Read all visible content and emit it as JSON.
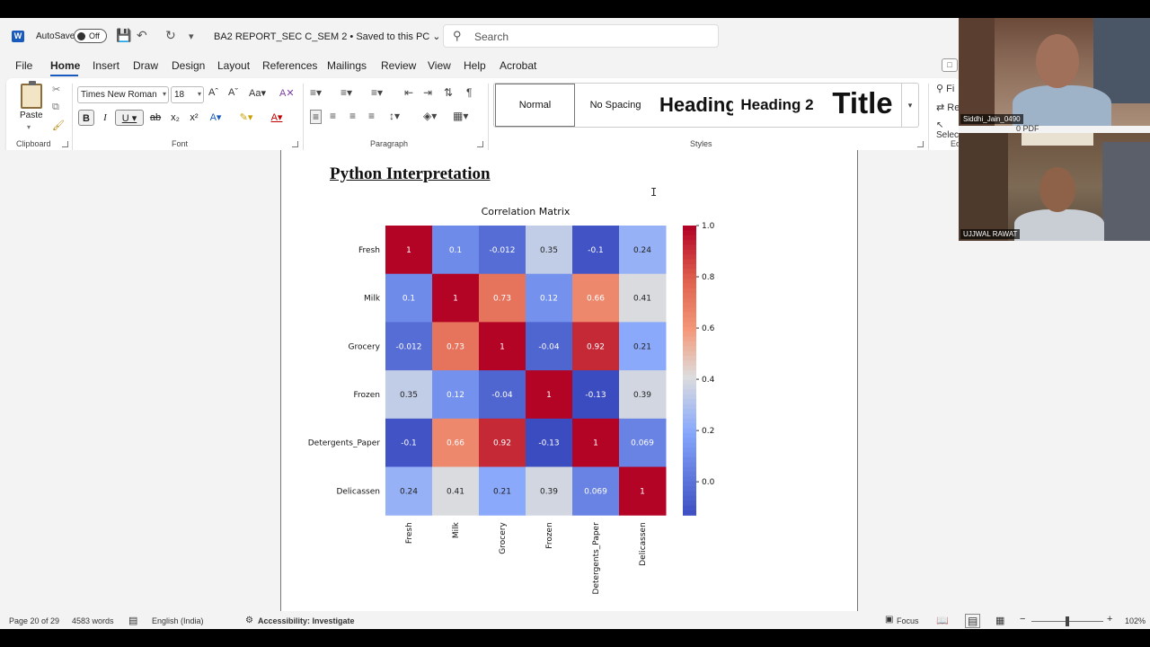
{
  "titlebar": {
    "autosave_label": "AutoSave",
    "autosave_state": "Off",
    "doc_title": "BA2 REPORT_SEC C_SEM 2 • Saved to this PC ⌄",
    "search_placeholder": "Search"
  },
  "menu": {
    "tabs": [
      "File",
      "Home",
      "Insert",
      "Draw",
      "Design",
      "Layout",
      "References",
      "Mailings",
      "Review",
      "View",
      "Help",
      "Acrobat"
    ]
  },
  "ribbon": {
    "clipboard": {
      "paste_label": "Paste",
      "group_label": "Clipboard"
    },
    "font": {
      "family": "Times New Roman",
      "size": "18",
      "group_label": "Font"
    },
    "paragraph": {
      "group_label": "Paragraph"
    },
    "styles": {
      "group_label": "Styles",
      "items": [
        "Normal",
        "No Spacing",
        "Heading 1",
        "Heading 2",
        "Title"
      ]
    },
    "editing": {
      "find_label": "Fi",
      "replace_label": "Re",
      "select_label": "Select",
      "group_label": "Ed"
    }
  },
  "document": {
    "heading": "Python Interpretation"
  },
  "chart_data": {
    "type": "heatmap",
    "title": "Correlation Matrix",
    "rows": [
      "Fresh",
      "Milk",
      "Grocery",
      "Frozen",
      "Detergents_Paper",
      "Delicassen"
    ],
    "cols": [
      "Fresh",
      "Milk",
      "Grocery",
      "Frozen",
      "Detergents_Paper",
      "Delicassen"
    ],
    "values": [
      [
        1,
        0.1,
        -0.012,
        0.35,
        -0.1,
        0.24
      ],
      [
        0.1,
        1,
        0.73,
        0.12,
        0.66,
        0.41
      ],
      [
        -0.012,
        0.73,
        1,
        -0.04,
        0.92,
        0.21
      ],
      [
        0.35,
        0.12,
        -0.04,
        1,
        -0.13,
        0.39
      ],
      [
        -0.1,
        0.66,
        0.92,
        -0.13,
        1,
        0.069
      ],
      [
        0.24,
        0.41,
        0.21,
        0.39,
        0.069,
        1
      ]
    ],
    "colormap": "coolwarm",
    "vmin": -0.13,
    "vmax": 1.0,
    "colorbar_ticks": [
      "1.0",
      "0.8",
      "0.6",
      "0.4",
      "0.2",
      "0.0"
    ]
  },
  "statusbar": {
    "page": "Page 20 of 29",
    "words": "4583 words",
    "language": "English (India)",
    "accessibility": "Accessibility: Investigate",
    "focus": "Focus",
    "zoom": "102%"
  },
  "video": {
    "participant1": "Siddhi_Jain_0490",
    "participant2": "UJJWAL RAWAT",
    "behind_text": "0 PDF"
  },
  "colors": {
    "accent": "#185abd",
    "heat_low": "#3b4cc0",
    "heat_mid": "#dddddd",
    "heat_high": "#b40426"
  }
}
